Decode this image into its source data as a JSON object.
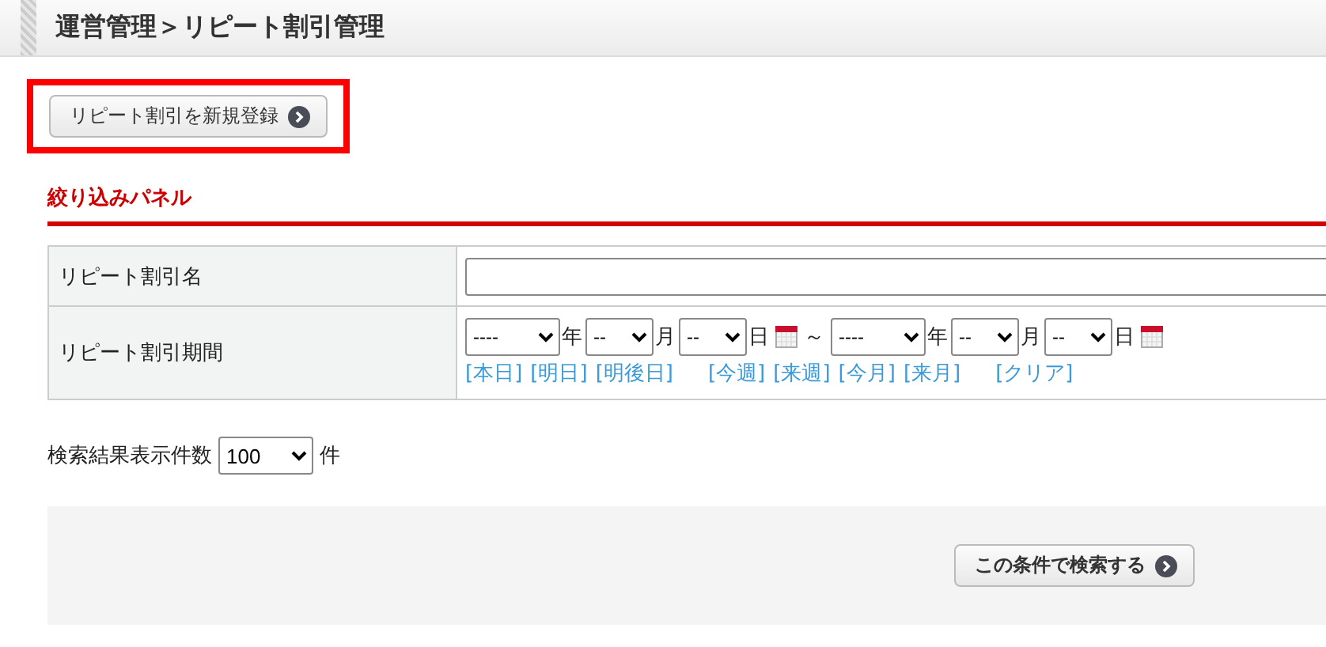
{
  "header": {
    "title": "運営管理＞リピート割引管理"
  },
  "new_button": {
    "label": "リピート割引を新規登録",
    "highlighted": true
  },
  "filter_panel": {
    "title": "絞り込みパネル",
    "name_row": {
      "label": "リピート割引名"
    },
    "period_row": {
      "label": "リピート割引期間",
      "from": [
        {
          "value": "----",
          "unit": "年"
        },
        {
          "value": "--",
          "unit": "月"
        },
        {
          "value": "--",
          "unit": "日"
        }
      ],
      "separator": "～",
      "to": [
        {
          "value": "----",
          "unit": "年"
        },
        {
          "value": "--",
          "unit": "月"
        },
        {
          "value": "--",
          "unit": "日"
        }
      ],
      "link_groups": [
        [
          "[本日]",
          "[明日]",
          "[明後日]"
        ],
        [
          "[今週]",
          "[来週]",
          "[今月]",
          "[来月]"
        ],
        [
          "[クリア]"
        ]
      ]
    }
  },
  "result_count": {
    "label": "検索結果表示件数",
    "value": "100",
    "unit": "件"
  },
  "search_button": {
    "label": "この条件で検索する"
  }
}
